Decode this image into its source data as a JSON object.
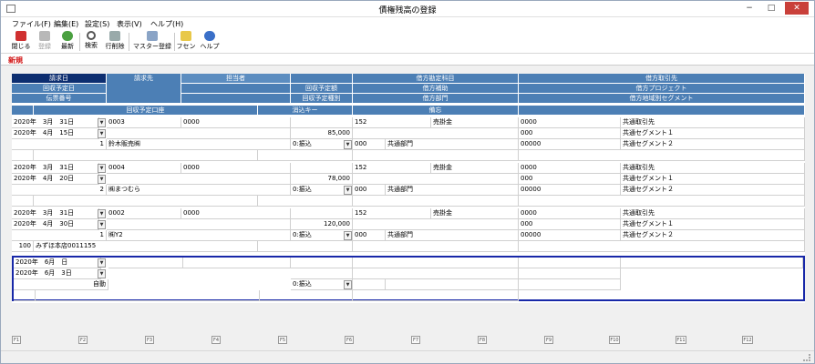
{
  "window": {
    "title": "債権残高の登録",
    "minimize": "−",
    "maximize": "□",
    "close": "✕"
  },
  "menu": [
    "ファイル(F)",
    "編集(E)",
    "設定(S)",
    "表示(V)",
    "ヘルプ(H)"
  ],
  "toolbar": {
    "close": "閉じる",
    "register": "登録",
    "refresh": "最新",
    "search": "検索",
    "delete_row": "行削除",
    "master": "マスター登録",
    "fusen": "フセン",
    "help": "ヘルプ"
  },
  "colors": {
    "header": "#4c7fb5",
    "header_dark": "#0d2e70",
    "selection_border": "#1828a8",
    "mode_label": "#d01010"
  },
  "mode_label": "新規",
  "headers": {
    "invoice_date": "請求日",
    "due_date": "回収予定日",
    "slip_no": "伝票番号",
    "customer": "請求先",
    "staff": "担当者",
    "collect_amount": "回収予定額",
    "collect_type": "回収予定種別",
    "debit_account": "借方勘定科目",
    "debit_sub": "借方補助",
    "debit_dept": "借方部門",
    "debit_partner": "借方取引先",
    "debit_project": "借方プロジェクト",
    "debit_segment": "借方地域別セグメント",
    "collect_account": "回収予定口座",
    "clearing_key": "消込キー",
    "memo": "備忘"
  },
  "records": [
    {
      "invoice_date": "2020年　3月　31日",
      "due_date": "2020年　4月　15日",
      "slip_no": "1",
      "customer_code": "0003",
      "staff_code": "0000",
      "customer_name": "鈴木販売㈱",
      "amount": "85,000",
      "type": "0:振込",
      "account_code": "152",
      "account_name": "売掛金",
      "sub_code": "",
      "dept_code": "000",
      "dept_name": "共通部門",
      "partner_code": "0000",
      "partner_name": "共通取引先",
      "project_code": "000",
      "project_name": "共通セグメント１",
      "segment_code": "00000",
      "segment_name": "共通セグメント２",
      "bank_code": "",
      "bank_name": ""
    },
    {
      "invoice_date": "2020年　3月　31日",
      "due_date": "2020年　4月　20日",
      "slip_no": "2",
      "customer_code": "0004",
      "staff_code": "0000",
      "customer_name": "㈱まつむら",
      "amount": "78,000",
      "type": "0:振込",
      "account_code": "152",
      "account_name": "売掛金",
      "sub_code": "",
      "dept_code": "000",
      "dept_name": "共通部門",
      "partner_code": "0000",
      "partner_name": "共通取引先",
      "project_code": "000",
      "project_name": "共通セグメント１",
      "segment_code": "00000",
      "segment_name": "共通セグメント２",
      "bank_code": "",
      "bank_name": ""
    },
    {
      "invoice_date": "2020年　3月　31日",
      "due_date": "2020年　4月　30日",
      "slip_no": "1",
      "customer_code": "0002",
      "staff_code": "0000",
      "customer_name": "㈱Y2",
      "amount": "120,000",
      "type": "0:振込",
      "account_code": "152",
      "account_name": "売掛金",
      "sub_code": "",
      "dept_code": "000",
      "dept_name": "共通部門",
      "partner_code": "0000",
      "partner_name": "共通取引先",
      "project_code": "000",
      "project_name": "共通セグメント１",
      "segment_code": "00000",
      "segment_name": "共通セグメント２",
      "bank_code": "100",
      "bank_name": "みずほ本店0011155"
    }
  ],
  "new_record": {
    "invoice_date": "2020年　6月　日",
    "due_date": "2020年　6月　3日",
    "slip_no": "自動",
    "type": "0:振込"
  },
  "fkeys": [
    "F1",
    "F2",
    "F3",
    "F4",
    "F5",
    "F6",
    "F7",
    "F8",
    "F9",
    "F10",
    "F11",
    "F12"
  ]
}
